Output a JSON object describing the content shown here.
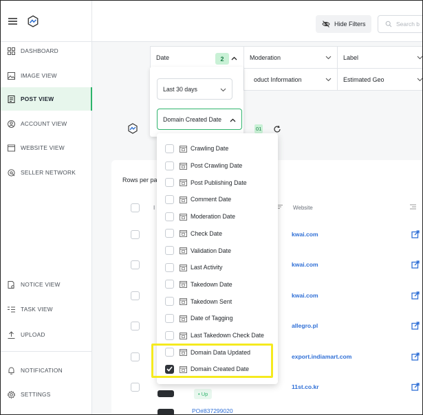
{
  "sidebar": {
    "items": [
      {
        "label": "DASHBOARD",
        "icon": "dashboard-icon"
      },
      {
        "label": "IMAGE VIEW",
        "icon": "image-icon"
      },
      {
        "label": "POST VIEW",
        "icon": "post-icon",
        "active": true
      },
      {
        "label": "ACCOUNT VIEW",
        "icon": "account-icon"
      },
      {
        "label": "WEBSITE VIEW",
        "icon": "website-icon"
      },
      {
        "label": "SELLER NETWORK",
        "icon": "network-icon"
      },
      {
        "label": "NOTICE VIEW",
        "icon": "notice-icon"
      },
      {
        "label": "TASK VIEW",
        "icon": "task-icon"
      },
      {
        "label": "UPLOAD",
        "icon": "upload-icon"
      },
      {
        "label": "NOTIFICATION",
        "icon": "bell-icon"
      },
      {
        "label": "SETTINGS",
        "icon": "gear-icon"
      }
    ]
  },
  "topbar": {
    "hide_filters_label": "Hide Filters",
    "search_placeholder": "Search b"
  },
  "filters": {
    "date_label": "Date",
    "date_count": "2",
    "moderation_label": "Moderation",
    "label_label": "Label",
    "product_info_label": "oduct Information",
    "estimated_geo_label": "Estimated Geo"
  },
  "date_panel": {
    "range_value": "Last 30 days",
    "field_value": "Domain Created Date"
  },
  "date_options": [
    {
      "label": "Crawling Date",
      "checked": false
    },
    {
      "label": "Post Crawling Date",
      "checked": false
    },
    {
      "label": "Post Publishing Date",
      "checked": false
    },
    {
      "label": "Comment Date",
      "checked": false
    },
    {
      "label": "Moderation Date",
      "checked": false
    },
    {
      "label": "Check Date",
      "checked": false
    },
    {
      "label": "Validation Date",
      "checked": false
    },
    {
      "label": "Last Activity",
      "checked": false
    },
    {
      "label": "Takedown Date",
      "checked": false
    },
    {
      "label": "Takedown Sent",
      "checked": false
    },
    {
      "label": "Date of Tagging",
      "checked": false
    },
    {
      "label": "Last Takedown Check Date",
      "checked": false
    },
    {
      "label": "Domain Data Updated",
      "checked": false
    },
    {
      "label": "Domain Created Date",
      "checked": true
    }
  ],
  "content": {
    "tag_text": "01",
    "rows_per_page_label": "Rows per pa",
    "col_i": "I",
    "col_website": "Website",
    "websites": [
      "kwai.com",
      "kwai.com",
      "kwai.com",
      "allegro.pl",
      "export.indiamart.com",
      "11st.co.kr"
    ],
    "status_up": "• Up",
    "post_link": "PO#837299020"
  },
  "colors": {
    "accent_green": "#2db36b",
    "link_blue": "#2f6fd6",
    "highlight_yellow": "#f5ea1e"
  }
}
